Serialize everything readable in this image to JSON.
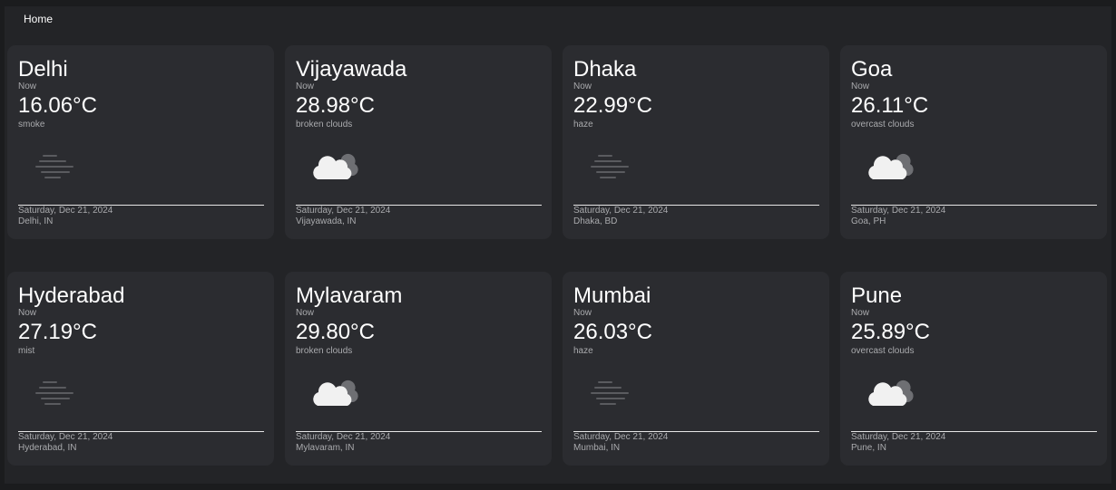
{
  "nav": {
    "home_label": "Home"
  },
  "cards": [
    {
      "city": "Delhi",
      "now": "Now",
      "temp": "16.06°C",
      "desc": "smoke",
      "icon": "mist-icon",
      "date": "Saturday, Dec 21, 2024",
      "location": "Delhi, IN"
    },
    {
      "city": "Vijayawada",
      "now": "Now",
      "temp": "28.98°C",
      "desc": "broken clouds",
      "icon": "cloud-icon",
      "date": "Saturday, Dec 21, 2024",
      "location": "Vijayawada, IN"
    },
    {
      "city": "Dhaka",
      "now": "Now",
      "temp": "22.99°C",
      "desc": "haze",
      "icon": "mist-icon",
      "date": "Saturday, Dec 21, 2024",
      "location": "Dhaka, BD"
    },
    {
      "city": "Goa",
      "now": "Now",
      "temp": "26.11°C",
      "desc": "overcast clouds",
      "icon": "cloud-icon",
      "date": "Saturday, Dec 21, 2024",
      "location": "Goa, PH"
    },
    {
      "city": "Hyderabad",
      "now": "Now",
      "temp": "27.19°C",
      "desc": "mist",
      "icon": "mist-icon",
      "date": "Saturday, Dec 21, 2024",
      "location": "Hyderabad, IN"
    },
    {
      "city": "Mylavaram",
      "now": "Now",
      "temp": "29.80°C",
      "desc": "broken clouds",
      "icon": "cloud-icon",
      "date": "Saturday, Dec 21, 2024",
      "location": "Mylavaram, IN"
    },
    {
      "city": "Mumbai",
      "now": "Now",
      "temp": "26.03°C",
      "desc": "haze",
      "icon": "mist-icon",
      "date": "Saturday, Dec 21, 2024",
      "location": "Mumbai, IN"
    },
    {
      "city": "Pune",
      "now": "Now",
      "temp": "25.89°C",
      "desc": "overcast clouds",
      "icon": "cloud-icon",
      "date": "Saturday, Dec 21, 2024",
      "location": "Pune, IN"
    }
  ],
  "colors": {
    "page_background": "#1b1c1e",
    "panel_background": "#232427",
    "card_background": "#2b2c30",
    "primary_text": "#ffffff",
    "secondary_text": "#a9aaad",
    "divider": "#e6e6e6"
  }
}
